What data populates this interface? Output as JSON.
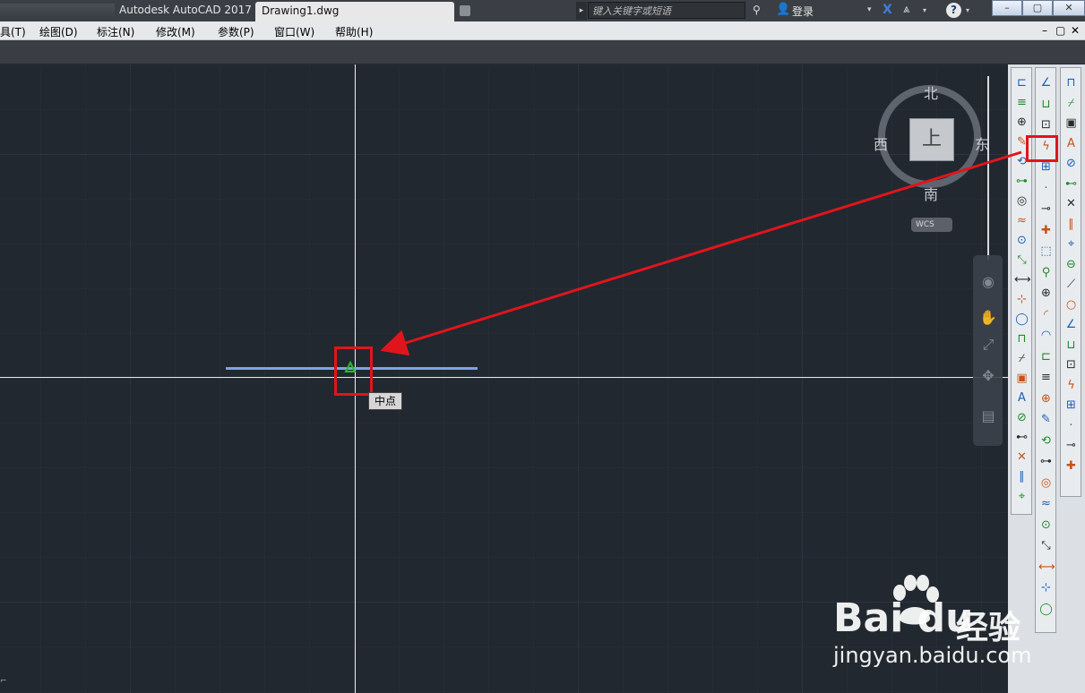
{
  "window": {
    "app_title": "Autodesk AutoCAD 2017",
    "doc_tab": "Drawing1.dwg",
    "search_placeholder": "键入关键字或短语",
    "login_label": "登录",
    "help_label": "?",
    "min_label": "–",
    "max_label": "▢",
    "close_label": "✕"
  },
  "menubar": {
    "items": [
      "具(T)",
      "绘图(D)",
      "标注(N)",
      "修改(M)",
      "参数(P)",
      "窗口(W)",
      "帮助(H)"
    ],
    "mdi_controls": [
      "–",
      "▢",
      "✕"
    ]
  },
  "viewcube": {
    "north": "北",
    "south": "南",
    "east": "东",
    "west": "西",
    "face": "上",
    "wcs": "WCS"
  },
  "drawing": {
    "snap_tooltip": "中点",
    "line_color": "#7ea3ea",
    "highlight_color": "#e0151b"
  },
  "watermark": {
    "brand": "Bai  du",
    "cn": "经验",
    "url": "jingyan.baidu.com"
  },
  "icons": {
    "toolbar_left": [
      "linear-dim-icon",
      "aligned-dim-icon",
      "arc-length-icon",
      "ordinate-icon",
      "circle-icon",
      "arc-icon",
      "ellipse-icon",
      "angular-icon",
      "quick-dim-icon",
      "baseline-icon",
      "continue-icon",
      "space-icon",
      "break-icon",
      "tolerance-icon",
      "center-mark-icon",
      "inspect-icon",
      "jogged-icon",
      "edit-dim-icon",
      "text-style-icon",
      "dim-style-icon",
      "update-icon",
      "override-icon"
    ],
    "toolbar_mid": [
      "temp-track-icon",
      "from-icon",
      "endpoint-icon",
      "midpoint-icon",
      "intersection-icon",
      "apparent-int-icon",
      "extension-icon",
      "center-icon",
      "quadrant-icon",
      "tangent-icon",
      "perpendicular-icon",
      "parallel-icon",
      "insert-icon",
      "node-icon",
      "nearest-icon",
      "none-icon",
      "osnap-settings-icon",
      "zoom-window-icon",
      "zoom-dynamic-icon",
      "zoom-scale-icon",
      "zoom-center-icon",
      "zoom-object-icon",
      "zoom-in-icon",
      "zoom-out-icon",
      "zoom-all-icon",
      "zoom-extents-icon"
    ],
    "toolbar_right": [
      "erase-icon",
      "copy-icon",
      "mirror-icon",
      "offset-icon",
      "array-icon",
      "move-icon",
      "rotate-icon",
      "scale-icon",
      "stretch-icon",
      "trim-icon",
      "extend-icon",
      "break-point-icon",
      "break-icon",
      "join-icon",
      "chamfer-icon",
      "fillet-icon",
      "blend-icon",
      "explode-icon",
      "group-icon",
      "ungroup-icon"
    ]
  }
}
